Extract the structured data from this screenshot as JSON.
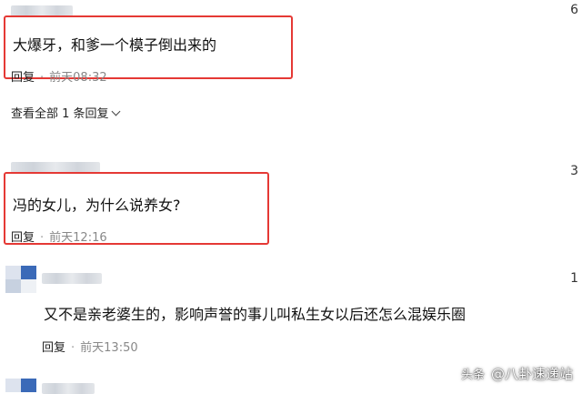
{
  "comments": [
    {
      "count": "6",
      "text": "大爆牙，和爹一个模子倒出来的",
      "reply_label": "回复",
      "time": "前天08:32",
      "view_all": "查看全部 1 条回复"
    },
    {
      "count": "3",
      "text": "冯的女儿，为什么说养女?",
      "reply_label": "回复",
      "time": "前天12:16"
    },
    {
      "count": "1",
      "text": "又不是亲老婆生的，影响声誉的事儿叫私生女以后还怎么混娱乐圈",
      "reply_label": "回复",
      "time": "前天13:50"
    }
  ],
  "watermark": {
    "platform": "头条",
    "handle": "@八卦速递站"
  },
  "colors": {
    "highlight_box": "#e53935",
    "avatar_blue": "#3b6ab8"
  }
}
